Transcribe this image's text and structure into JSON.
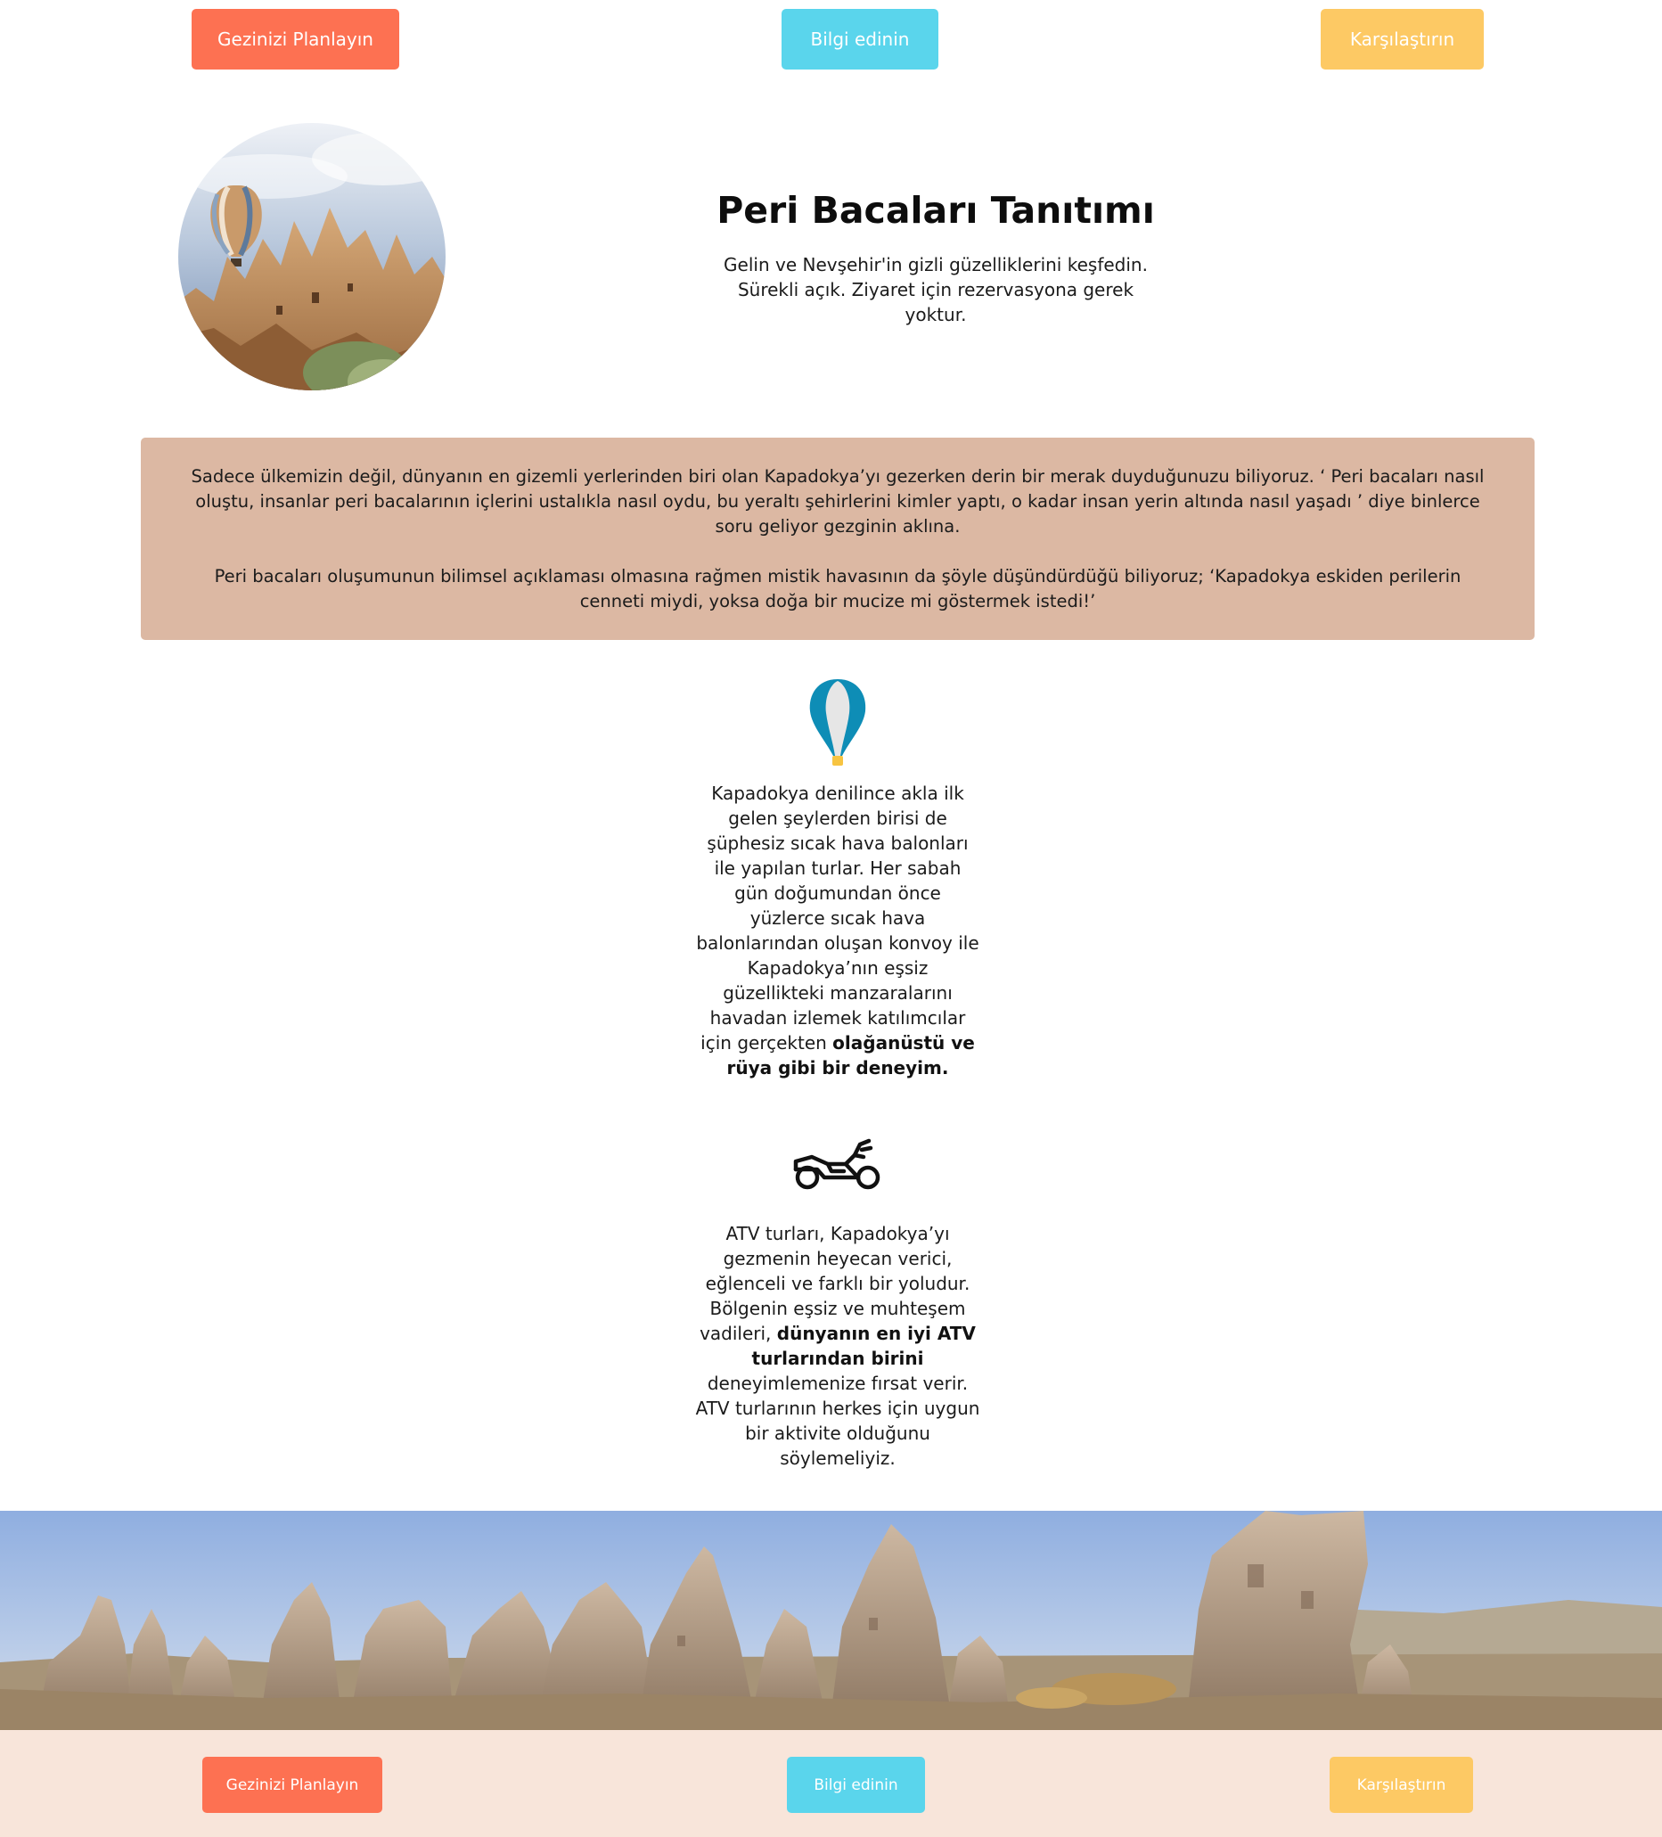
{
  "nav": {
    "plan_label": "Gezinizi Planlayın",
    "info_label": "Bilgi edinin",
    "compare_label": "Karşılaştırın"
  },
  "hero": {
    "title": "Peri Bacaları Tanıtımı",
    "subtitle": "Gelin ve Nevşehir'in gizli güzelliklerini keşfedin. Sürekli açık. Ziyaret için rezervasyona gerek yoktur.",
    "image_icon": "hot-air-balloon-over-fairy-chimneys-photo"
  },
  "intro": {
    "paragraph1": "Sadece ülkemizin değil, dünyanın en gizemli yerlerinden biri olan Kapadokya’yı gezerken derin bir merak duyduğunuzu biliyoruz. ‘ Peri bacaları nasıl oluştu, insanlar peri bacalarının içlerini ustalıkla nasıl oydu, bu yeraltı şehirlerini kimler yaptı, o kadar insan yerin altında nasıl yaşadı ’ diye binlerce soru geliyor gezginin aklına.",
    "paragraph2": "Peri bacaları oluşumunun bilimsel açıklaması olmasına rağmen mistik havasının da şöyle düşündürdüğü biliyoruz; ‘Kapadokya eskiden perilerin cenneti miydi, yoksa doğa bir mucize mi göstermek istedi!’"
  },
  "balloon_section": {
    "icon": "hot-air-balloon-icon",
    "text_plain": "Kapadokya denilince akla ilk gelen şeylerden birisi de şüphesiz sıcak hava balonları ile yapılan turlar. Her sabah gün doğumundan önce yüzlerce sıcak hava balonlarından oluşan konvoy ile Kapadokya’nın eşsiz güzellikteki manzaralarını havadan izlemek katılımcılar için gerçekten",
    "text_bold": "olağanüstü ve rüya gibi bir deneyim."
  },
  "atv_section": {
    "icon": "motorcycle-icon",
    "text_plain_1": "ATV turları, Kapadokya’yı gezmenin heyecan verici, eğlenceli ve farklı bir yoludur. Bölgenin eşsiz ve muhteşem vadileri,",
    "text_bold": "dünyanın en iyi ATV turlarından birini",
    "text_plain_2": "deneyimlemenize fırsat verir. ATV turlarının herkes için uygun bir aktivite olduğunu söylemeliyiz."
  },
  "landscape": {
    "image_icon": "fairy-chimneys-landscape-photo"
  },
  "footer": {
    "plan_label": "Gezinizi Planlayın",
    "info_label": "Bilgi edinin",
    "compare_label": "Karşılaştırın"
  },
  "colors": {
    "plan_button": "#fd7152",
    "info_button": "#5ad5ec",
    "compare_button": "#fdc964",
    "intro_box": "#dcb8a3",
    "footer_bg": "#f8e5da"
  }
}
